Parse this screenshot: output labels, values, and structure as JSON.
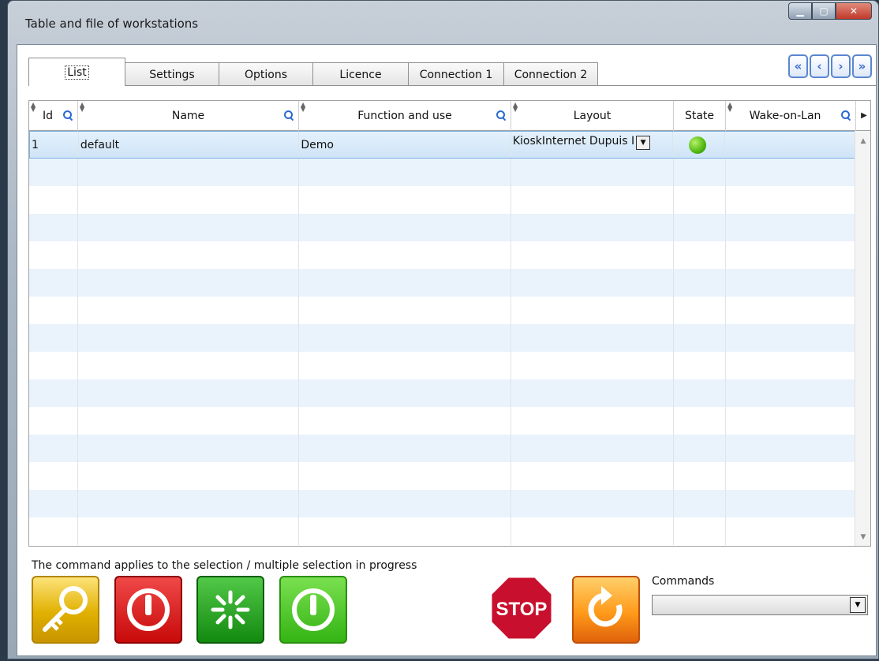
{
  "window": {
    "title": "Table and file of workstations"
  },
  "tabs": [
    {
      "label": "List"
    },
    {
      "label": "Settings"
    },
    {
      "label": "Options"
    },
    {
      "label": "Licence"
    },
    {
      "label": "Connection 1"
    },
    {
      "label": "Connection 2"
    }
  ],
  "nav": {
    "first": "«",
    "prev": "‹",
    "next": "›",
    "last": "»"
  },
  "grid": {
    "columns": [
      "Id",
      "Name",
      "Function and use",
      "Layout",
      "State",
      "Wake-on-Lan"
    ],
    "rows": [
      {
        "id": "1",
        "name": "default",
        "function": "Demo",
        "layout": "KioskInternet Dupuis I",
        "state": "green"
      }
    ]
  },
  "footer": {
    "note": "The command applies to the selection / multiple selection in progress",
    "commands_label": "Commands",
    "commands_value": "",
    "stop_label": "STOP"
  },
  "icons": {
    "key": "key-icon",
    "power_red": "power-icon",
    "restart": "restart-icon",
    "power_green": "power-on-icon",
    "stop": "stop-sign-icon",
    "refresh": "refresh-icon"
  },
  "colors": {
    "accent": "#2a6ad0",
    "selected_row": "#cfe4f7",
    "alt_row": "#eaf3fc",
    "state_on": "#4fb80f"
  }
}
